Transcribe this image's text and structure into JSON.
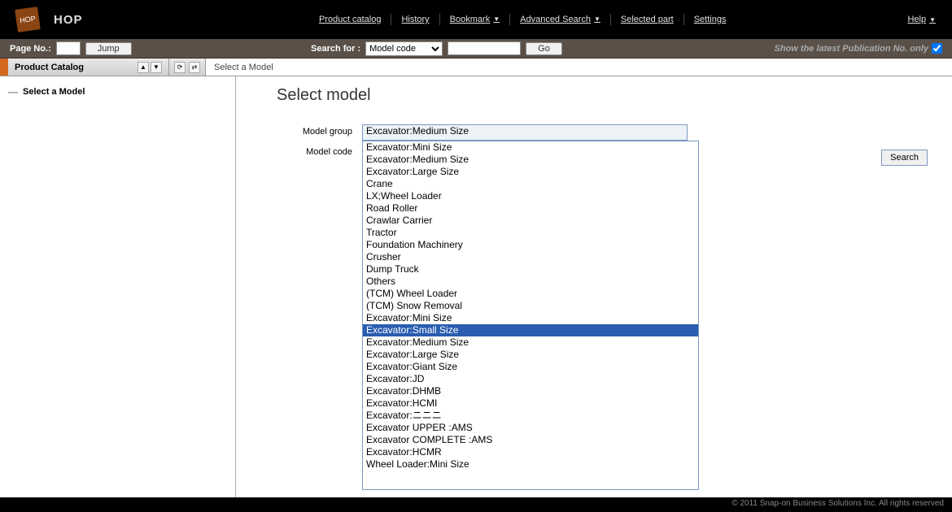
{
  "app": {
    "name": "HOP",
    "logo_label": "HOP"
  },
  "topnav": {
    "product_catalog": "Product catalog",
    "history": "History",
    "bookmark": "Bookmark",
    "advanced_search": "Advanced Search",
    "selected_part": "Selected part",
    "settings": "Settings",
    "help": "Help"
  },
  "toolbar": {
    "page_no_label": "Page No.:",
    "page_no_value": "",
    "jump": "Jump",
    "search_for_label": "Search for :",
    "search_for_select": "Model code",
    "search_for_value": "",
    "go": "Go",
    "latest_pub_label": "Show the latest Publication No. only",
    "latest_pub_checked": true
  },
  "panel": {
    "header": "Product Catalog",
    "breadcrumb": "Select a Model",
    "tree_item": "Select a Model"
  },
  "content": {
    "heading": "Select model",
    "labels": {
      "model_group": "Model group",
      "model_code": "Model code"
    },
    "model_group_selected": "Excavator:Medium Size",
    "search_button": "Search",
    "dropdown": {
      "highlighted_index": 15,
      "options": [
        "Excavator:Mini Size",
        "Excavator:Medium Size",
        "Excavator:Large Size",
        "Crane",
        "LX;Wheel Loader",
        "Road Roller",
        "Crawlar Carrier",
        "Tractor",
        "Foundation Machinery",
        "Crusher",
        "Dump Truck",
        "Others",
        "(TCM) Wheel Loader",
        "(TCM) Snow Removal",
        "Excavator:Mini Size",
        "Excavator:Small Size",
        "Excavator:Medium Size",
        "Excavator:Large Size",
        "Excavator:Giant Size",
        "Excavator:JD",
        "Excavator:DHMB",
        "Excavator:HCMI",
        "Excavator:ニニニ",
        "Excavator UPPER :AMS",
        "Excavator COMPLETE :AMS",
        "Excavator:HCMR",
        "Wheel Loader:Mini Size"
      ]
    }
  },
  "footer": {
    "copyright": "© 2011 Snap-on Business Solutions Inc. All rights reserved"
  }
}
